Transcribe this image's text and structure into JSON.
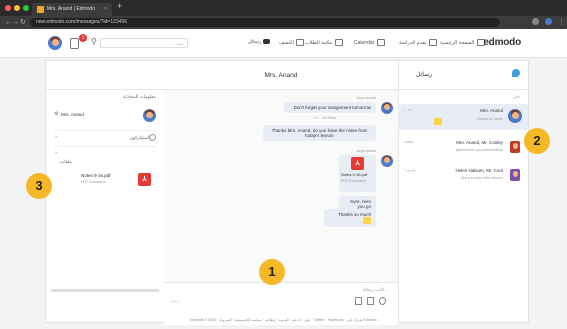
{
  "browser": {
    "tab_title": "Mrs. Anand | Edmodo",
    "tab_close": "×",
    "new_tab": "+",
    "url": "new.edmodo.com/messages/?id=123456"
  },
  "topnav": {
    "badge_count": "1",
    "search_placeholder": "بحث",
    "messages_label": "رسائل",
    "discover_label": "اكتشف",
    "library_label": "مكتبة الطلاب",
    "calendar_label": "Calendar",
    "progress_label": "تقدم الدراسة",
    "home_label": "الصفحة الرئيسية",
    "logo": "edmodo"
  },
  "left": {
    "header": "معلومات المحادثة",
    "participant_name": "Mrs. Anand",
    "participants_label": "المشاركون",
    "files_label": "ملفات",
    "file_name": "Notes 9-16.pdf",
    "file_type": "PDF Document"
  },
  "middle": {
    "title": "Mrs. Anand",
    "sender1": "Anya Anand",
    "msg1": "Don't forget your assignment tomorrow",
    "time1": "٢:٢٠ 10:30am",
    "msg2": "Thanks Mrs. Anand, do you have the notes from today's lesson",
    "sender2": "Anya Anand",
    "file_name": "Notes 9-16.pdf",
    "file_type": "PDF Document",
    "msg3": "Sure, here you go",
    "msg4": "Thanks so much",
    "input_placeholder": "اكتب رسالة...",
    "send_label": "إرسال"
  },
  "right": {
    "header": "رسائل",
    "section_label": "حالي",
    "thread1_name": "Mrs. Anand",
    "thread1_time": "١٠:٣٠",
    "thread1_preview": "Thanks so much",
    "thread2_name": "Mrs. Anand, Mr. Conley",
    "thread2_time": "الثلاثاء",
    "thread2_preview": "appreciated your presentation",
    "thread3_name": "Helen Halsum, Mr. Cool",
    "thread3_time": "مارس ١",
    "thread3_preview": "See you there Mrs Halsum"
  },
  "callouts": {
    "one": "1",
    "two": "2",
    "three": "3"
  },
  "footer": "Edmodo © 2020 · حول · الدعم · المدونة · وظائف · سياسة الخصوصية · الشروط · Twitter · Facebook · تعرف على Edmodo",
  "colors": {
    "accent": "#f6b826",
    "pdf": "#e53935",
    "brand": "#3aa1d8"
  }
}
